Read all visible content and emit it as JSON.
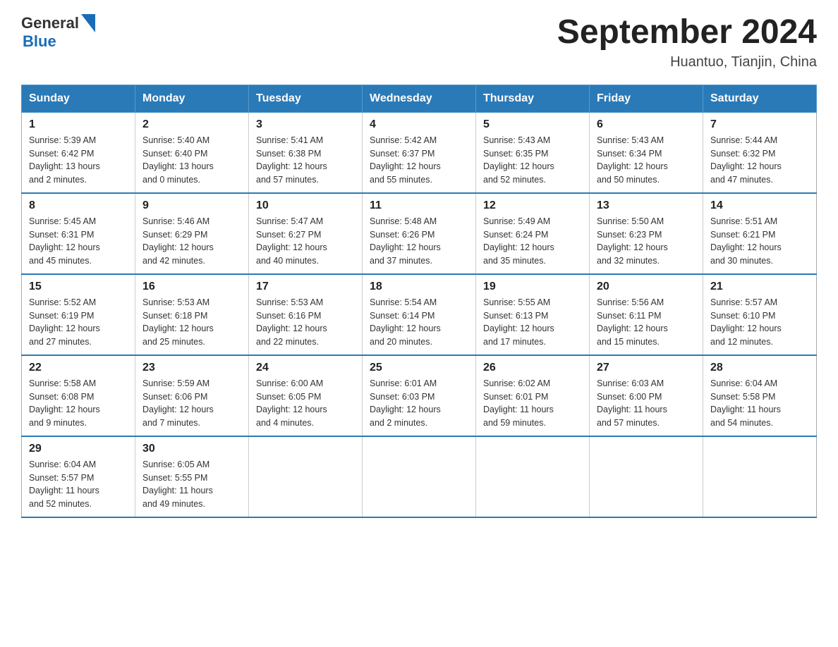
{
  "header": {
    "logo": {
      "general": "General",
      "blue": "Blue"
    },
    "title": "September 2024",
    "subtitle": "Huantuo, Tianjin, China"
  },
  "days_of_week": [
    "Sunday",
    "Monday",
    "Tuesday",
    "Wednesday",
    "Thursday",
    "Friday",
    "Saturday"
  ],
  "weeks": [
    [
      {
        "day": "1",
        "sunrise": "5:39 AM",
        "sunset": "6:42 PM",
        "daylight": "13 hours and 2 minutes."
      },
      {
        "day": "2",
        "sunrise": "5:40 AM",
        "sunset": "6:40 PM",
        "daylight": "13 hours and 0 minutes."
      },
      {
        "day": "3",
        "sunrise": "5:41 AM",
        "sunset": "6:38 PM",
        "daylight": "12 hours and 57 minutes."
      },
      {
        "day": "4",
        "sunrise": "5:42 AM",
        "sunset": "6:37 PM",
        "daylight": "12 hours and 55 minutes."
      },
      {
        "day": "5",
        "sunrise": "5:43 AM",
        "sunset": "6:35 PM",
        "daylight": "12 hours and 52 minutes."
      },
      {
        "day": "6",
        "sunrise": "5:43 AM",
        "sunset": "6:34 PM",
        "daylight": "12 hours and 50 minutes."
      },
      {
        "day": "7",
        "sunrise": "5:44 AM",
        "sunset": "6:32 PM",
        "daylight": "12 hours and 47 minutes."
      }
    ],
    [
      {
        "day": "8",
        "sunrise": "5:45 AM",
        "sunset": "6:31 PM",
        "daylight": "12 hours and 45 minutes."
      },
      {
        "day": "9",
        "sunrise": "5:46 AM",
        "sunset": "6:29 PM",
        "daylight": "12 hours and 42 minutes."
      },
      {
        "day": "10",
        "sunrise": "5:47 AM",
        "sunset": "6:27 PM",
        "daylight": "12 hours and 40 minutes."
      },
      {
        "day": "11",
        "sunrise": "5:48 AM",
        "sunset": "6:26 PM",
        "daylight": "12 hours and 37 minutes."
      },
      {
        "day": "12",
        "sunrise": "5:49 AM",
        "sunset": "6:24 PM",
        "daylight": "12 hours and 35 minutes."
      },
      {
        "day": "13",
        "sunrise": "5:50 AM",
        "sunset": "6:23 PM",
        "daylight": "12 hours and 32 minutes."
      },
      {
        "day": "14",
        "sunrise": "5:51 AM",
        "sunset": "6:21 PM",
        "daylight": "12 hours and 30 minutes."
      }
    ],
    [
      {
        "day": "15",
        "sunrise": "5:52 AM",
        "sunset": "6:19 PM",
        "daylight": "12 hours and 27 minutes."
      },
      {
        "day": "16",
        "sunrise": "5:53 AM",
        "sunset": "6:18 PM",
        "daylight": "12 hours and 25 minutes."
      },
      {
        "day": "17",
        "sunrise": "5:53 AM",
        "sunset": "6:16 PM",
        "daylight": "12 hours and 22 minutes."
      },
      {
        "day": "18",
        "sunrise": "5:54 AM",
        "sunset": "6:14 PM",
        "daylight": "12 hours and 20 minutes."
      },
      {
        "day": "19",
        "sunrise": "5:55 AM",
        "sunset": "6:13 PM",
        "daylight": "12 hours and 17 minutes."
      },
      {
        "day": "20",
        "sunrise": "5:56 AM",
        "sunset": "6:11 PM",
        "daylight": "12 hours and 15 minutes."
      },
      {
        "day": "21",
        "sunrise": "5:57 AM",
        "sunset": "6:10 PM",
        "daylight": "12 hours and 12 minutes."
      }
    ],
    [
      {
        "day": "22",
        "sunrise": "5:58 AM",
        "sunset": "6:08 PM",
        "daylight": "12 hours and 9 minutes."
      },
      {
        "day": "23",
        "sunrise": "5:59 AM",
        "sunset": "6:06 PM",
        "daylight": "12 hours and 7 minutes."
      },
      {
        "day": "24",
        "sunrise": "6:00 AM",
        "sunset": "6:05 PM",
        "daylight": "12 hours and 4 minutes."
      },
      {
        "day": "25",
        "sunrise": "6:01 AM",
        "sunset": "6:03 PM",
        "daylight": "12 hours and 2 minutes."
      },
      {
        "day": "26",
        "sunrise": "6:02 AM",
        "sunset": "6:01 PM",
        "daylight": "11 hours and 59 minutes."
      },
      {
        "day": "27",
        "sunrise": "6:03 AM",
        "sunset": "6:00 PM",
        "daylight": "11 hours and 57 minutes."
      },
      {
        "day": "28",
        "sunrise": "6:04 AM",
        "sunset": "5:58 PM",
        "daylight": "11 hours and 54 minutes."
      }
    ],
    [
      {
        "day": "29",
        "sunrise": "6:04 AM",
        "sunset": "5:57 PM",
        "daylight": "11 hours and 52 minutes."
      },
      {
        "day": "30",
        "sunrise": "6:05 AM",
        "sunset": "5:55 PM",
        "daylight": "11 hours and 49 minutes."
      },
      null,
      null,
      null,
      null,
      null
    ]
  ],
  "labels": {
    "sunrise": "Sunrise:",
    "sunset": "Sunset:",
    "daylight": "Daylight:"
  }
}
